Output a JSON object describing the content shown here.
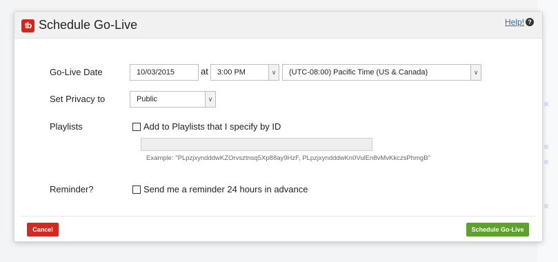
{
  "dialog": {
    "title": "Schedule Go-Live",
    "logo_text": "tb",
    "help_label": "Help!",
    "help_icon": "?"
  },
  "form": {
    "go_live_date": {
      "label": "Go-Live Date",
      "date_value": "10/03/2015",
      "at_text": "at",
      "time_value": "3:00 PM",
      "timezone_value": "(UTC-08:00) Pacific Time (US & Canada)"
    },
    "privacy": {
      "label": "Set Privacy to",
      "value": "Public"
    },
    "playlists": {
      "label": "Playlists",
      "checkbox_label": "Add to Playlists that I specify by ID",
      "checked": false,
      "input_value": "",
      "example_text": "Example: \"PLpzjxyndddwKZOrvsztnsq5Xp88ay9HzF, PLpzjxyndddwKn0VulEn8vMvKkczsPhmgB\""
    },
    "reminder": {
      "label": "Reminder?",
      "checkbox_label": "Send me a reminder 24 hours in advance",
      "checked": false
    }
  },
  "buttons": {
    "cancel_label": "Cancel",
    "schedule_label": "Schedule Go-Live"
  },
  "colors": {
    "brand": "#d9241c",
    "cancel": "#d12a22",
    "primary": "#5fa12e",
    "link": "#2a6ebb"
  }
}
